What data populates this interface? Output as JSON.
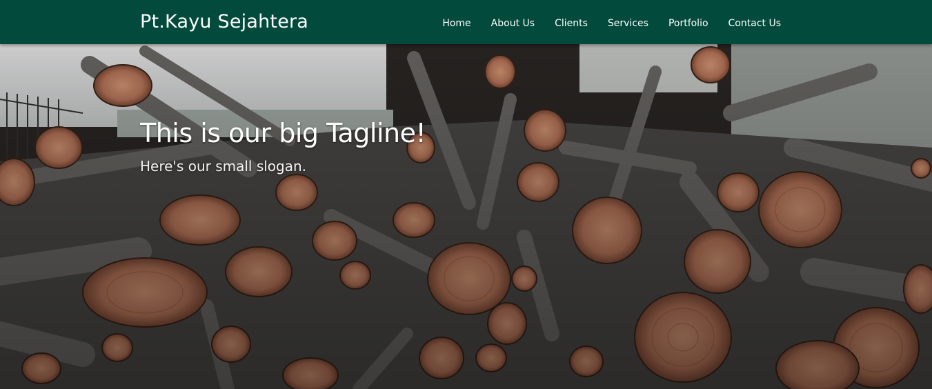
{
  "navbar": {
    "brand": "Pt.Kayu Sejahtera",
    "links": [
      "Home",
      "About Us",
      "Clients",
      "Services",
      "Portfolio",
      "Contact Us"
    ]
  },
  "hero": {
    "tagline": "This is our big Tagline!",
    "slogan": "Here's our small slogan."
  },
  "colors": {
    "navbar_bg": "#024b3c",
    "text": "#ffffff",
    "wood_cut": "#c98a6a",
    "bark": "#5a5755"
  }
}
